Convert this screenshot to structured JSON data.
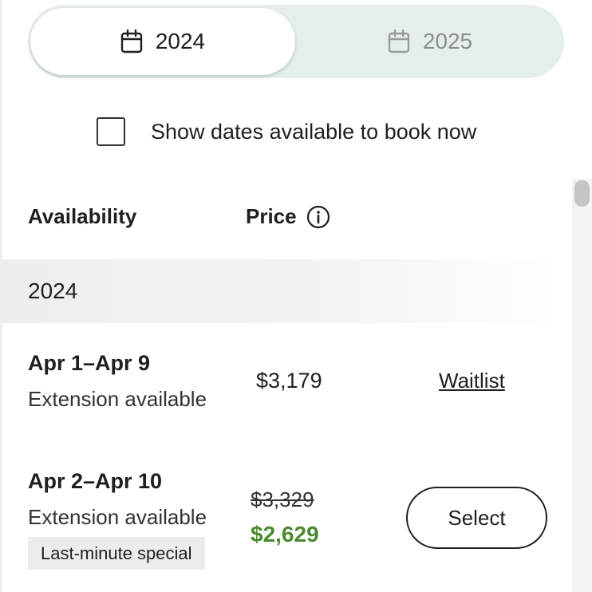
{
  "year_toggle": {
    "options": [
      {
        "label": "2024",
        "icon": "calendar-icon",
        "active": true
      },
      {
        "label": "2025",
        "icon": "calendar-icon",
        "active": false
      }
    ]
  },
  "filter": {
    "checkbox_label": "Show dates available to book now",
    "checked": false
  },
  "table": {
    "headers": {
      "availability": "Availability",
      "price": "Price",
      "price_info_icon": "info-icon"
    },
    "year_group": "2024",
    "rows": [
      {
        "dates": "Apr 1–Apr 9",
        "extension": "Extension available",
        "price": "$3,179",
        "action": "Waitlist"
      },
      {
        "dates": "Apr 2–Apr 10",
        "extension": "Extension available",
        "badge": "Last-minute special",
        "original_price": "$3,329",
        "sale_price": "$2,629",
        "action": "Select"
      }
    ]
  },
  "colors": {
    "toggle_bg": "#e4efed",
    "sale_price": "#4a8a2e",
    "badge_bg": "#ececec"
  }
}
